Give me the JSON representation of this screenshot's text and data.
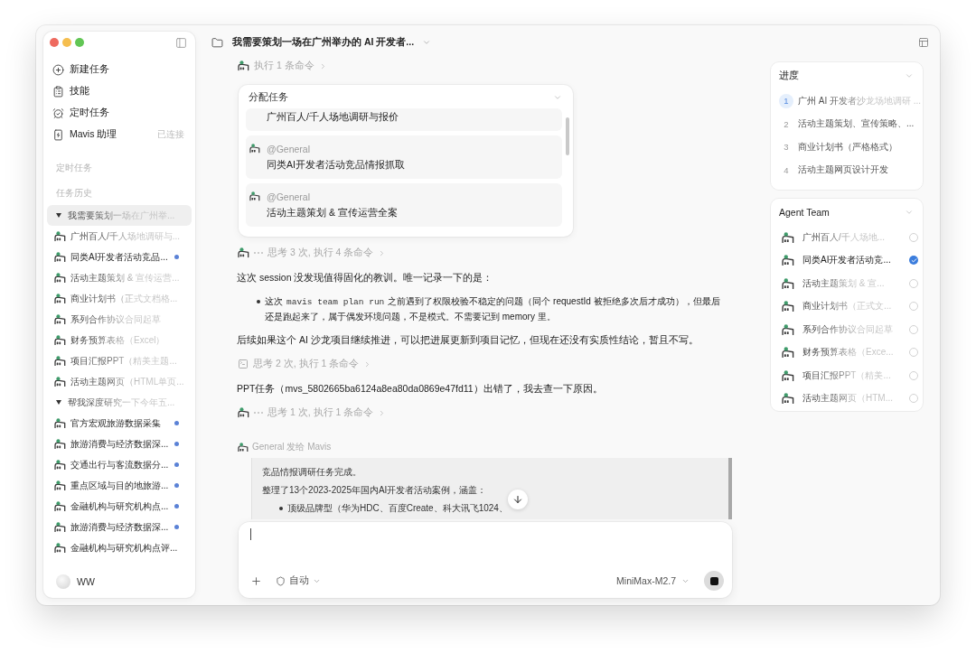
{
  "window": {
    "title": "我需要策划一场在广州举办的 AI 开发者..."
  },
  "sidebar": {
    "menu": [
      {
        "label": "新建任务"
      },
      {
        "label": "技能"
      },
      {
        "label": "定时任务"
      },
      {
        "label": "Mavis 助理",
        "status": "已连接"
      }
    ],
    "scheduled_heading": "定时任务",
    "history_heading": "任务历史",
    "history": [
      {
        "title": "我需要策划一场在广州举...",
        "selected": true,
        "expanded": true,
        "running": true,
        "children": [
          {
            "title": "广州百人/千人场地调研与...",
            "selected": false,
            "running": true,
            "unread": false
          },
          {
            "title": "同类AI开发者活动竞品...",
            "selected": false,
            "running": false,
            "unread": true
          },
          {
            "title": "活动主题策划 & 宣传运营...",
            "selected": false,
            "running": true,
            "unread": false
          },
          {
            "title": "商业计划书（正式文档格...",
            "selected": false,
            "running": true,
            "unread": false
          },
          {
            "title": "系列合作协议合同起草",
            "selected": false,
            "running": true,
            "unread": false
          },
          {
            "title": "财务预算表格（Excel）",
            "selected": false,
            "running": true,
            "unread": false
          },
          {
            "title": "项目汇报PPT（精美主题...",
            "selected": false,
            "running": true,
            "unread": false
          },
          {
            "title": "活动主题网页（HTML单页...",
            "selected": false,
            "running": true,
            "unread": false
          }
        ]
      },
      {
        "title": "帮我深度研究一下今年五...",
        "selected": false,
        "expanded": true,
        "running": true,
        "children": [
          {
            "title": "官方宏观旅游数据采集",
            "selected": false,
            "running": false,
            "unread": true
          },
          {
            "title": "旅游消费与经济数据深...",
            "selected": false,
            "running": false,
            "unread": true
          },
          {
            "title": "交通出行与客流数据分...",
            "selected": false,
            "running": false,
            "unread": true
          },
          {
            "title": "重点区域与目的地旅游...",
            "selected": false,
            "running": false,
            "unread": true
          },
          {
            "title": "金融机构与研究机构点...",
            "selected": false,
            "running": false,
            "unread": true
          },
          {
            "title": "旅游消费与经济数据深...",
            "selected": false,
            "running": false,
            "unread": true
          },
          {
            "title": "金融机构与研究机构点评...",
            "selected": false,
            "running": false,
            "unread": false
          }
        ]
      }
    ],
    "user": {
      "name": "WW"
    }
  },
  "main": {
    "conversation": [
      {
        "kind": "agent_step",
        "busy": false,
        "text": "执行 1 条命令"
      },
      {
        "kind": "assign_card",
        "title": "分配任务",
        "expanded": true,
        "tasks": [
          {
            "task": "广州百人/千人场地调研与报价"
          },
          {
            "agent": "@General",
            "task": "同类AI开发者活动竞品情报抓取"
          },
          {
            "agent": "@General",
            "task": "活动主题策划 & 宣传运营全案"
          }
        ]
      },
      {
        "kind": "agent_step",
        "busy": true,
        "text": "思考 3 次, 执行 4 条命令"
      },
      {
        "kind": "paragraph",
        "text": "这次 session 没发现值得固化的教训。唯一记录一下的是："
      },
      {
        "kind": "bullets",
        "items": [
          {
            "before": "这次",
            "code": "mavis team plan run",
            "after": "之前遇到了权限校验不稳定的问题（同个 requestId 被拒绝多次后才成功），但最后还是跑起来了，属于偶发环境问题，不是模式。不需要记到 memory 里。"
          }
        ]
      },
      {
        "kind": "paragraph",
        "text": "后续如果这个 AI 沙龙项目继续推进，可以把进展更新到项目记忆，但现在还没有实质性结论，暂且不写。"
      },
      {
        "kind": "tool_step",
        "text": "思考 2 次, 执行 1 条命令"
      },
      {
        "kind": "paragraph",
        "text": "PPT任务（mvs_5802665ba6124a8ea80da0869e47fd11）出错了，我去查一下原因。"
      },
      {
        "kind": "agent_step",
        "busy": true,
        "text": "思考 1 次, 执行 1 条命令"
      },
      {
        "kind": "message",
        "sender": "General 发给 Mavis",
        "paragraphs": [
          "竞品情报调研任务完成。",
          "整理了13个2023-2025年国内AI开发者活动案例，涵盖："
        ],
        "bullets": [
          "顶级品牌型（华为HDC、百度Create、科大讯飞1024、"
        ]
      }
    ]
  },
  "composer": {
    "mode": "自动",
    "model": "MiniMax-M2.7"
  },
  "progress": {
    "title": "进度",
    "expanded": true,
    "steps": [
      {
        "number": "1",
        "label": "广州 AI 开发者沙龙场地调研 ...",
        "current": true
      },
      {
        "number": "2",
        "label": "活动主题策划、宣传策略、...",
        "current": false
      },
      {
        "number": "3",
        "label": "商业计划书（严格格式）",
        "current": false
      },
      {
        "number": "4",
        "label": "活动主题网页设计开发",
        "current": false
      }
    ]
  },
  "agent_team": {
    "title": "Agent Team",
    "expanded": true,
    "agents": [
      {
        "name": "广州百人/千人场地...",
        "checked": false
      },
      {
        "name": "同类AI开发者活动竞...",
        "checked": true
      },
      {
        "name": "活动主题策划 & 宣...",
        "checked": false
      },
      {
        "name": "商业计划书（正式文...",
        "checked": false
      },
      {
        "name": "系列合作协议合同起草",
        "checked": false
      },
      {
        "name": "财务预算表格（Exce...",
        "checked": false
      },
      {
        "name": "项目汇报PPT（精美...",
        "checked": false
      },
      {
        "name": "活动主题网页（HTM...",
        "checked": false
      }
    ]
  }
}
